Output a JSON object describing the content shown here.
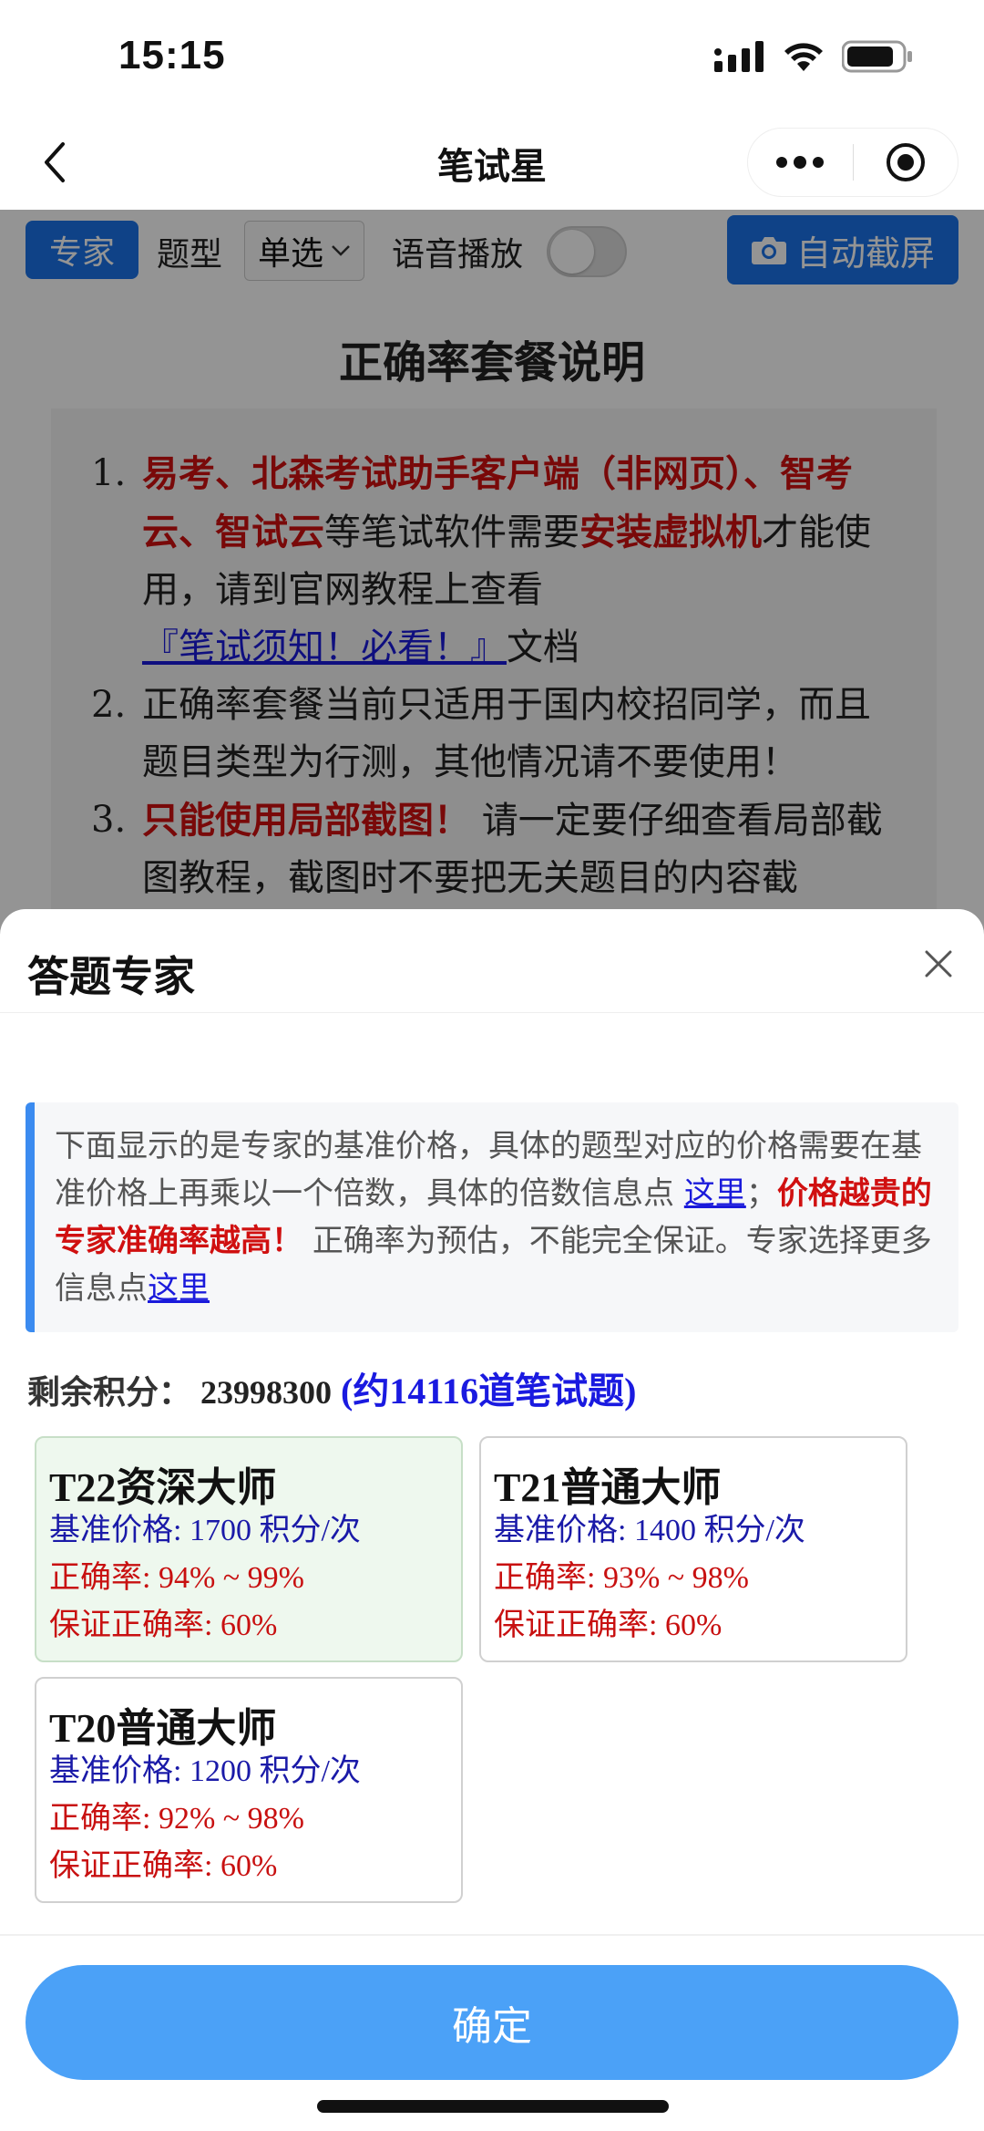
{
  "status": {
    "time": "15:15"
  },
  "nav": {
    "title": "笔试星"
  },
  "toolbar": {
    "expert_label": "专家",
    "type_label": "题型",
    "type_value": "单选",
    "voice_label": "语音播放",
    "screenshot_label": "自动截屏"
  },
  "doc": {
    "title": "正确率套餐说明",
    "items": [
      {
        "num": "1.",
        "red1": "易考、北森考试助手客户端（非网页）、智考云、智试云",
        "t1": "等笔试软件需要",
        "red2": "安装虚拟机",
        "t2": "才能使用，请到官网教程上查看",
        "link": "『笔试须知！必看！』",
        "t3": "文档"
      },
      {
        "num": "2.",
        "text": "正确率套餐当前只适用于国内校招同学，而且题目类型为行测，其他情况请不要使用！"
      },
      {
        "num": "3.",
        "red": "只能使用局部截图！",
        "text": "请一定要仔细查看局部截图教程，截图时不要把无关题目的内容截"
      }
    ]
  },
  "sheet": {
    "title": "答题专家",
    "notice": {
      "t1": "下面显示的是专家的基准价格，具体的题型对应的价格需要在基准价格上再乘以一个倍数，具体的倍数信息点 ",
      "link1": "这里",
      "t2": "；",
      "warn": "价格越贵的专家准确率越高！",
      "t3": "正确率为预估，不能完全保证。专家选择更多信息点",
      "link2": "这里"
    },
    "points_label": "剩余积分：",
    "points_value": "23998300",
    "points_estimate": "(约14116道笔试题)",
    "experts": [
      {
        "name": "T22资深大师",
        "price": "基准价格: 1700 积分/次",
        "accuracy": "正确率: 94% ~ 99%",
        "guarantee": "保证正确率: 60%"
      },
      {
        "name": "T21普通大师",
        "price": "基准价格: 1400 积分/次",
        "accuracy": "正确率: 93% ~ 98%",
        "guarantee": "保证正确率: 60%"
      },
      {
        "name": "T20普通大师",
        "price": "基准价格: 1200 积分/次",
        "accuracy": "正确率: 92% ~ 98%",
        "guarantee": "保证正确率: 60%"
      }
    ],
    "confirm_label": "确定"
  },
  "colors": {
    "accent": "#1a73e8",
    "confirm": "#4ba1f7",
    "warn_red": "#d01010",
    "link_blue": "#1a1adb"
  },
  "icons": [
    "signal-icon",
    "wifi-icon",
    "battery-icon",
    "back-icon",
    "more-icon",
    "record-icon",
    "camera-icon",
    "chevron-down-icon",
    "close-icon"
  ]
}
